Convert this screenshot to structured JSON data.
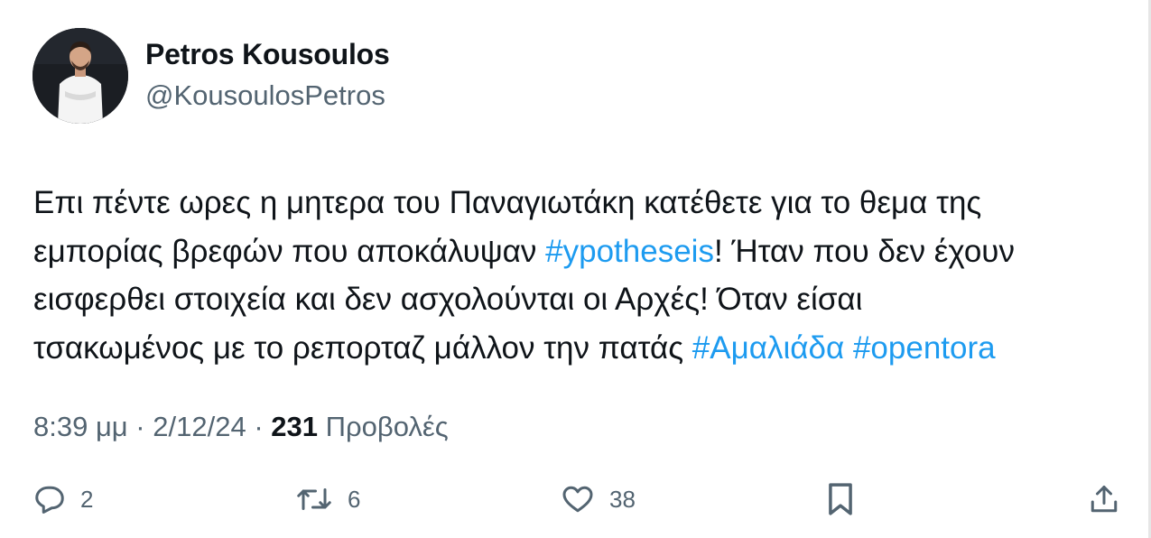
{
  "author": {
    "name": "Petros Kousoulos",
    "handle": "@KousoulosPetros"
  },
  "tweet": {
    "line1": "Επι πέντε ωρες η μητερα του Παναγιωτάκη κατέθετε για το θεμα της",
    "line2_pre": "εμπορίας βρεφών που αποκάλυψαν ",
    "hashtag_ypotheseis": "#ypotheseis",
    "line2_post": "! Ήταν που δεν έχουν",
    "line3": "εισφερθει στοιχεία και δεν ασχολούνται οι Αρχές! Όταν είσαι",
    "line4_pre": "τσακωμένος με το ρεπορταζ μάλλον την πατάς ",
    "hashtag_amaliada": "#Αμαλιάδα",
    "hashtag_opentora": "#opentora"
  },
  "meta": {
    "time": "8:39 μμ",
    "separator": "·",
    "date": "2/12/24",
    "views_count": "231",
    "views_label": "Προβολές"
  },
  "actions": {
    "reply": {
      "icon": "reply-icon",
      "count": "2"
    },
    "retweet": {
      "icon": "retweet-icon",
      "count": "6"
    },
    "like": {
      "icon": "heart-icon",
      "count": "38"
    },
    "bookmark": {
      "icon": "bookmark-icon"
    },
    "share": {
      "icon": "share-icon"
    }
  },
  "colors": {
    "text": "#0f1419",
    "secondary": "#536471",
    "link": "#1d9bf0"
  }
}
